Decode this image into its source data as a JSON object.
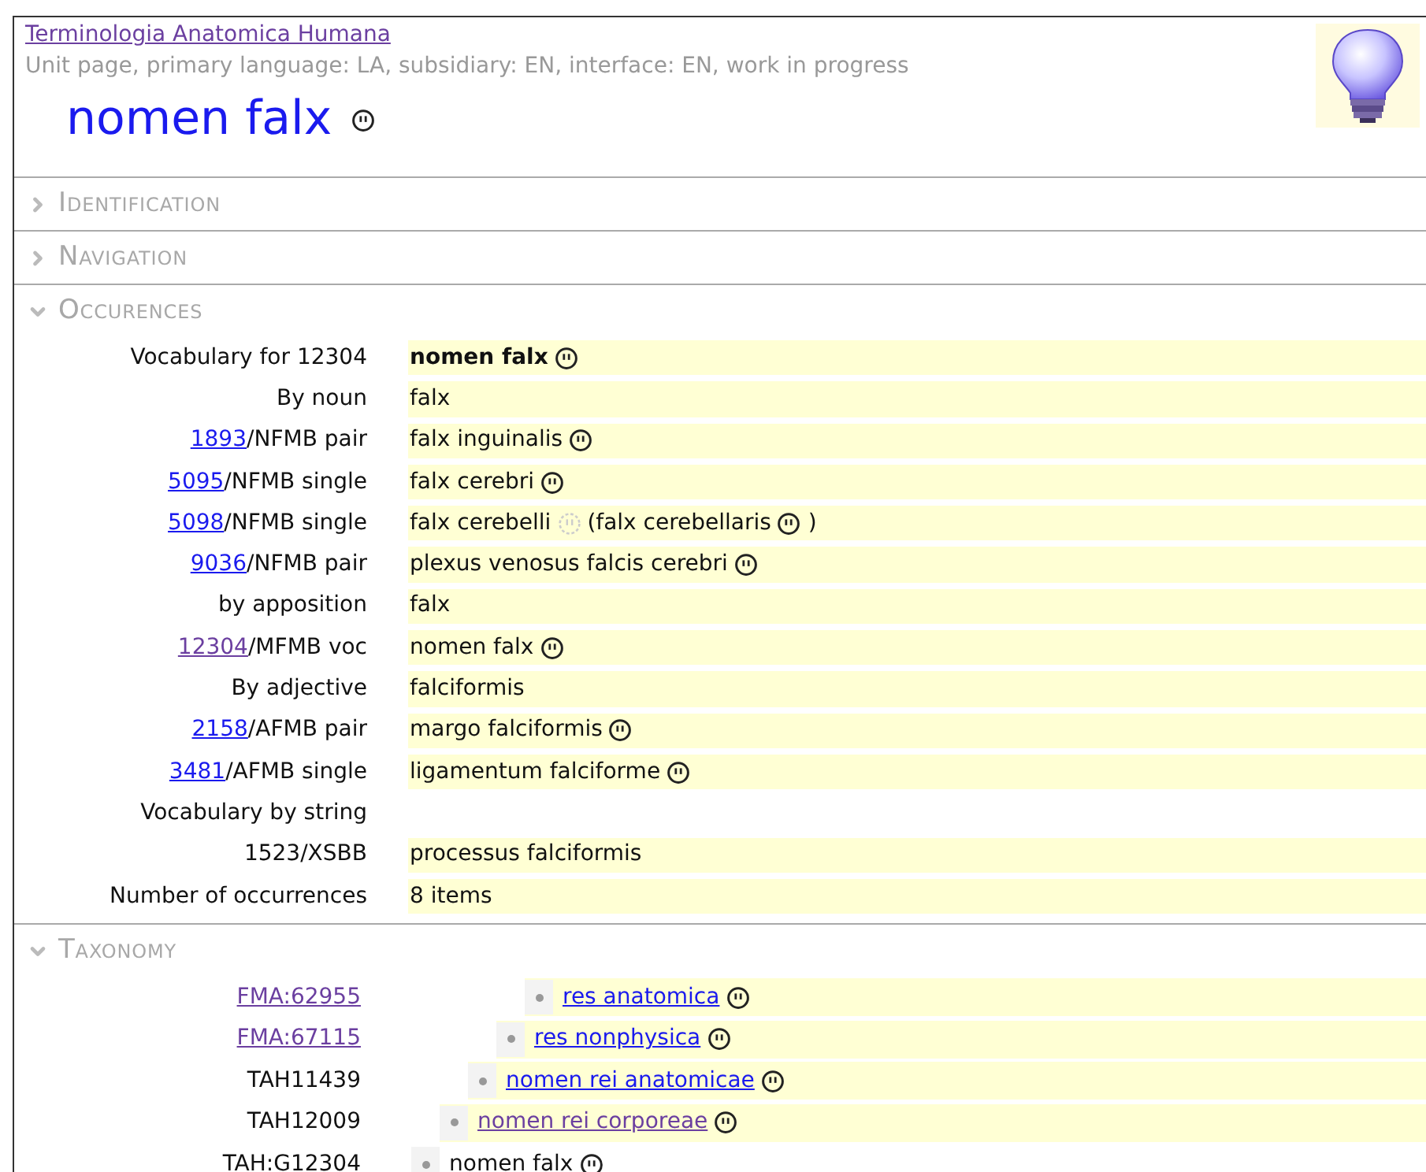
{
  "header": {
    "site_link": {
      "text": "Terminologia Anatomica Humana",
      "visited": true
    },
    "subtitle": "Unit page, primary language: LA, subsidiary: EN, interface: EN, work in progress",
    "title": "nomen falx"
  },
  "sections": [
    {
      "title": "Identification",
      "expanded": false
    },
    {
      "title": "Navigation",
      "expanded": false
    },
    {
      "title": "Occurences",
      "expanded": true,
      "kind": "occurrences",
      "rows": [
        {
          "label": "Vocabulary for 12304",
          "highlight": true,
          "bold": true,
          "parts": [
            {
              "text": "nomen falx",
              "kind": "symbol"
            }
          ]
        },
        {
          "label": "By noun",
          "highlight": true,
          "parts": [
            {
              "text": "falx"
            }
          ]
        },
        {
          "link": {
            "text": "1893",
            "visited": false
          },
          "label": "/NFMB pair",
          "highlight": true,
          "parts": [
            {
              "text": "falx inguinalis",
              "kind": "symbol"
            }
          ]
        },
        {
          "link": {
            "text": "5095",
            "visited": false
          },
          "label": "/NFMB single",
          "highlight": true,
          "parts": [
            {
              "text": "falx cerebri",
              "kind": "symbol"
            }
          ]
        },
        {
          "link": {
            "text": "5098",
            "visited": false
          },
          "label": "/NFMB single",
          "highlight": true,
          "parts": [
            {
              "text": "falx cerebelli",
              "kind": "faint"
            },
            {
              "text": "(falx cerebellaris",
              "kind": "symbol"
            },
            {
              "text": ")",
              "kind": "plain"
            }
          ]
        },
        {
          "link": {
            "text": "9036",
            "visited": false
          },
          "label": "/NFMB pair",
          "highlight": true,
          "parts": [
            {
              "text": "plexus venosus falcis cerebri",
              "kind": "symbol"
            }
          ]
        },
        {
          "label": "by apposition",
          "highlight": true,
          "parts": [
            {
              "text": "falx"
            }
          ]
        },
        {
          "link": {
            "text": "12304",
            "visited": true
          },
          "label": "/MFMB voc",
          "highlight": true,
          "parts": [
            {
              "text": "nomen falx",
              "kind": "symbol"
            }
          ]
        },
        {
          "label": "By adjective",
          "highlight": true,
          "parts": [
            {
              "text": "falciformis"
            }
          ]
        },
        {
          "link": {
            "text": "2158",
            "visited": false
          },
          "label": "/AFMB pair",
          "highlight": true,
          "parts": [
            {
              "text": "margo falciformis",
              "kind": "symbol"
            }
          ]
        },
        {
          "link": {
            "text": "3481",
            "visited": false
          },
          "label": "/AFMB single",
          "highlight": true,
          "parts": [
            {
              "text": "ligamentum falciforme",
              "kind": "symbol"
            }
          ]
        },
        {
          "label": "Vocabulary by string",
          "highlight": false,
          "parts": []
        },
        {
          "label": "1523/XSBB",
          "highlight": true,
          "parts": [
            {
              "text": "processus falciformis"
            }
          ]
        },
        {
          "label": "Number of occurrences",
          "highlight": true,
          "parts": [
            {
              "text": "8 items"
            }
          ]
        }
      ]
    },
    {
      "title": "Taxonomy",
      "expanded": true,
      "kind": "taxonomy",
      "tree": [
        {
          "id": {
            "text": "FMA:62955",
            "link": true,
            "visited": true
          },
          "name": {
            "text": "res anatomica",
            "link": true,
            "visited": false
          },
          "highlight": true,
          "children": [
            {
              "id": {
                "text": "FMA:67115",
                "link": true,
                "visited": true
              },
              "name": {
                "text": "res nonphysica",
                "link": true,
                "visited": false
              },
              "highlight": true,
              "children": [
                {
                  "id": {
                    "text": "TAH11439",
                    "link": false
                  },
                  "name": {
                    "text": "nomen rei anatomicae",
                    "link": true,
                    "visited": false
                  },
                  "highlight": true,
                  "children": [
                    {
                      "id": {
                        "text": "TAH12009",
                        "link": false
                      },
                      "name": {
                        "text": "nomen rei corporeae",
                        "link": true,
                        "visited": true
                      },
                      "highlight": true,
                      "children": [
                        {
                          "id": {
                            "text": "TAH:G12304",
                            "link": false
                          },
                          "name": {
                            "text": "nomen falx",
                            "link": false
                          },
                          "highlight": false
                        }
                      ]
                    }
                  ]
                }
              ]
            }
          ]
        }
      ]
    }
  ]
}
